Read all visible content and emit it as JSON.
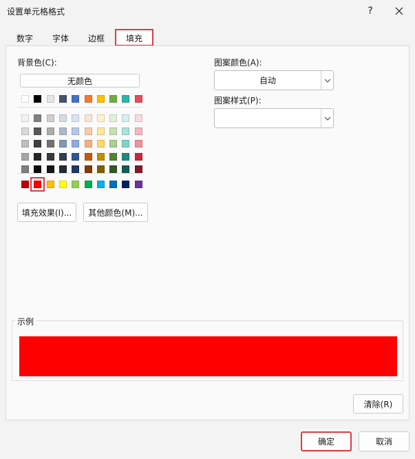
{
  "window": {
    "title": "设置单元格格式",
    "help_glyph": "?"
  },
  "tabs": [
    {
      "label": "数字"
    },
    {
      "label": "字体"
    },
    {
      "label": "边框"
    },
    {
      "label": "填充",
      "active": true
    }
  ],
  "background": {
    "label": "背景色(C):",
    "no_color_label": "无颜色",
    "top_row": [
      "#ffffff",
      "#000000",
      "#e7e6e6",
      "#44546a",
      "#4472c4",
      "#ed7d31",
      "#ffc000",
      "#70ad47",
      "#2cb5a8",
      "#e84c5c"
    ],
    "grid": [
      [
        "#f2f2f2",
        "#7f7f7f",
        "#d0cece",
        "#d6dce5",
        "#dae3f3",
        "#fbe5d6",
        "#fff2cc",
        "#e2f0d9",
        "#d5f0ec",
        "#fadadd"
      ],
      [
        "#d9d9d9",
        "#595959",
        "#aeabab",
        "#adb9ca",
        "#b4c7e7",
        "#f8cbad",
        "#ffe699",
        "#c5e0b4",
        "#aae1da",
        "#f5b6bd"
      ],
      [
        "#bfbfbf",
        "#3f3f3f",
        "#757171",
        "#8497b0",
        "#8faadc",
        "#f4b183",
        "#ffd966",
        "#a9d18e",
        "#7fd3c8",
        "#f0919c"
      ],
      [
        "#a6a6a6",
        "#262626",
        "#3a3838",
        "#323f4f",
        "#2f5597",
        "#c55a11",
        "#bf9000",
        "#538135",
        "#208a80",
        "#c6283c"
      ],
      [
        "#7f7f7f",
        "#0c0c0c",
        "#171616",
        "#222a35",
        "#203864",
        "#843c0c",
        "#7f6000",
        "#375623",
        "#155c55",
        "#841b28"
      ]
    ],
    "standard_row": [
      "#c00000",
      "#ff0000",
      "#ffc000",
      "#ffff00",
      "#92d050",
      "#00b050",
      "#00b0f0",
      "#0070c0",
      "#002060",
      "#7030a0"
    ],
    "selected_standard_index": 1,
    "fill_effects_label": "填充效果(I)...",
    "more_colors_label": "其他颜色(M)..."
  },
  "pattern": {
    "color_label": "图案颜色(A):",
    "color_value": "自动",
    "style_label": "图案样式(P):",
    "style_value": ""
  },
  "sample": {
    "label": "示例",
    "color": "#ff0000"
  },
  "actions": {
    "clear_label": "清除(R)",
    "ok_label": "确定",
    "cancel_label": "取消"
  },
  "colors": {
    "accent_highlight": "#e03a3e"
  }
}
